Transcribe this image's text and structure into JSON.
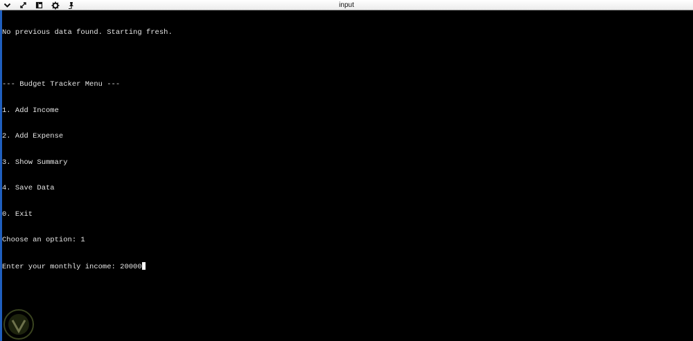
{
  "window": {
    "title": "input",
    "toolbar_icons": [
      "chevron-down-icon",
      "resize-icon",
      "window-icon",
      "gear-icon",
      "pin-icon"
    ]
  },
  "console": {
    "lines": [
      "No previous data found. Starting fresh.",
      "",
      "--- Budget Tracker Menu ---",
      "1. Add Income",
      "2. Add Expense",
      "3. Show Summary",
      "4. Save Data",
      "0. Exit",
      "Choose an option: 1"
    ],
    "prompt": "Enter your monthly income: ",
    "input_value": "20000"
  },
  "colors": {
    "background": "#000000",
    "text": "#e6e6e6",
    "titlebar": "#f2f2f2",
    "accent_edge": "#1f5fbf"
  }
}
